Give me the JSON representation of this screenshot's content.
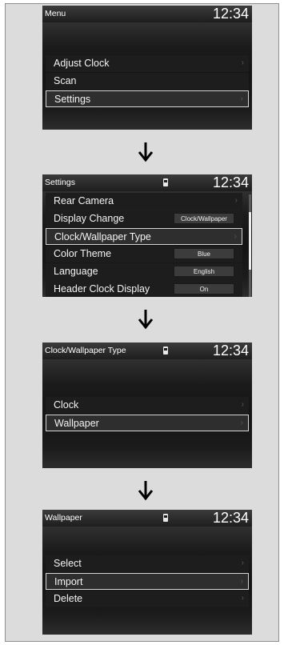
{
  "clock": "12:34",
  "screens": {
    "menu": {
      "title": "Menu",
      "items": [
        "Adjust Clock",
        "Scan",
        "Settings"
      ],
      "selected": "Settings"
    },
    "settings": {
      "title": "Settings",
      "items": [
        {
          "label": "Rear Camera"
        },
        {
          "label": "Display Change",
          "value": "Clock/Wallpaper"
        },
        {
          "label": "Clock/Wallpaper Type"
        },
        {
          "label": "Color Theme",
          "value": "Blue"
        },
        {
          "label": "Language",
          "value": "English"
        },
        {
          "label": "Header Clock Display",
          "value": "On"
        }
      ],
      "selected": "Clock/Wallpaper Type"
    },
    "clock_wallpaper_type": {
      "title": "Clock/Wallpaper Type",
      "items": [
        "Clock",
        "Wallpaper"
      ],
      "selected": "Wallpaper"
    },
    "wallpaper": {
      "title": "Wallpaper",
      "items": [
        "Select",
        "Import",
        "Delete"
      ],
      "selected": "Import"
    }
  },
  "icons": {
    "chevron": "chevron-right-icon",
    "phone": "phone-icon",
    "flow_arrow": "down-arrow-icon"
  }
}
